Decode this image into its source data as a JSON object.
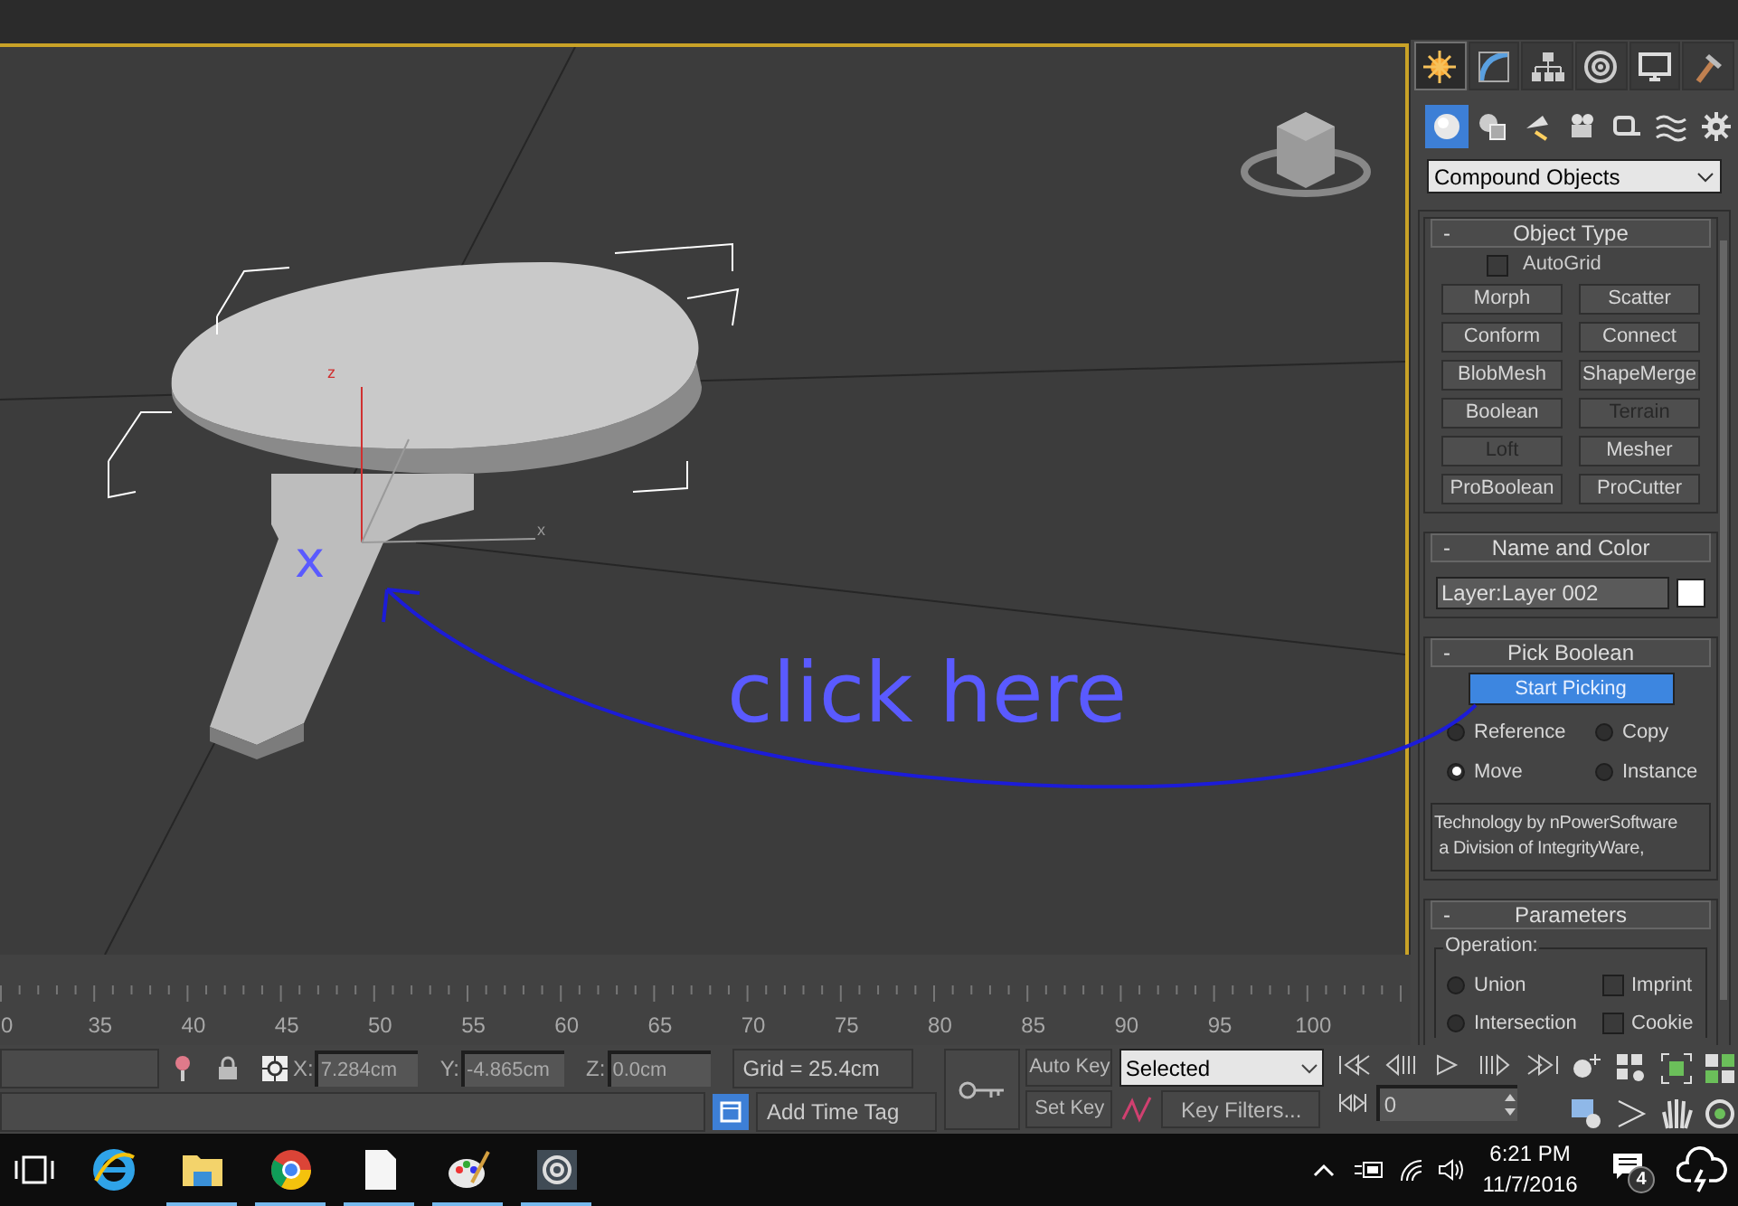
{
  "viewport": {
    "axis_labels": [
      "z",
      "x"
    ],
    "annotation": {
      "mark": "x",
      "text": "click here"
    }
  },
  "command_panel": {
    "tabs": [
      {
        "selected": true
      },
      {
        "selected": false
      },
      {
        "selected": false
      },
      {
        "selected": false
      },
      {
        "selected": false
      },
      {
        "selected": false
      }
    ],
    "categories": [
      {
        "selected": true
      },
      {
        "selected": false
      },
      {
        "selected": false
      },
      {
        "selected": false
      },
      {
        "selected": false
      },
      {
        "selected": false
      },
      {
        "selected": false
      }
    ],
    "dropdown": "Compound Objects",
    "object_type": {
      "collapse": "-",
      "title": "Object Type",
      "autogrid": {
        "label": "AutoGrid",
        "checked": false
      },
      "buttons": [
        {
          "label": "Morph",
          "disabled": false
        },
        {
          "label": "Scatter",
          "disabled": false
        },
        {
          "label": "Conform",
          "disabled": false
        },
        {
          "label": "Connect",
          "disabled": false
        },
        {
          "label": "BlobMesh",
          "disabled": false
        },
        {
          "label": "ShapeMerge",
          "disabled": false
        },
        {
          "label": "Boolean",
          "disabled": false
        },
        {
          "label": "Terrain",
          "disabled": true
        },
        {
          "label": "Loft",
          "disabled": true
        },
        {
          "label": "Mesher",
          "disabled": false
        },
        {
          "label": "ProBoolean",
          "disabled": false
        },
        {
          "label": "ProCutter",
          "disabled": false
        }
      ]
    },
    "name_and_color": {
      "collapse": "-",
      "title": "Name and Color",
      "name": "Layer:Layer 002",
      "color": "#ffffff"
    },
    "pick_boolean": {
      "collapse": "-",
      "title": "Pick Boolean",
      "button": "Start Picking",
      "options": [
        {
          "label": "Reference",
          "selected": false
        },
        {
          "label": "Copy",
          "selected": false
        },
        {
          "label": "Move",
          "selected": true
        },
        {
          "label": "Instance",
          "selected": false
        }
      ],
      "credits": "Technology by nPowerSoftware\n a Division of IntegrityWare,"
    },
    "parameters": {
      "collapse": "-",
      "title": "Parameters",
      "group_label": "Operation:",
      "operations": [
        {
          "label": "Union",
          "selected": false
        },
        {
          "label": "Intersection",
          "selected": false
        }
      ],
      "flags": [
        {
          "label": "Imprint",
          "checked": false
        },
        {
          "label": "Cookie",
          "checked": false
        }
      ]
    }
  },
  "timeline": {
    "labels": [
      "0",
      "35",
      "40",
      "45",
      "50",
      "55",
      "60",
      "65",
      "70",
      "75",
      "80",
      "85",
      "90",
      "95",
      "100"
    ]
  },
  "status": {
    "coords": [
      {
        "axis": "X:",
        "value": "7.284cm"
      },
      {
        "axis": "Y:",
        "value": "-4.865cm"
      },
      {
        "axis": "Z:",
        "value": "0.0cm"
      }
    ],
    "grid": "Grid = 25.4cm",
    "time_tag": "Add Time Tag",
    "auto_key": "Auto Key",
    "key_mode": "Selected",
    "set_key": "Set Key",
    "key_filters": "Key Filters...",
    "frame": "0"
  },
  "taskbar": {
    "apps": [
      {
        "running": false
      },
      {
        "running": true
      },
      {
        "running": true
      },
      {
        "running": true
      },
      {
        "running": true
      },
      {
        "running": true
      }
    ],
    "time": "6:21 PM",
    "date": "11/7/2016",
    "notifications": "4"
  }
}
